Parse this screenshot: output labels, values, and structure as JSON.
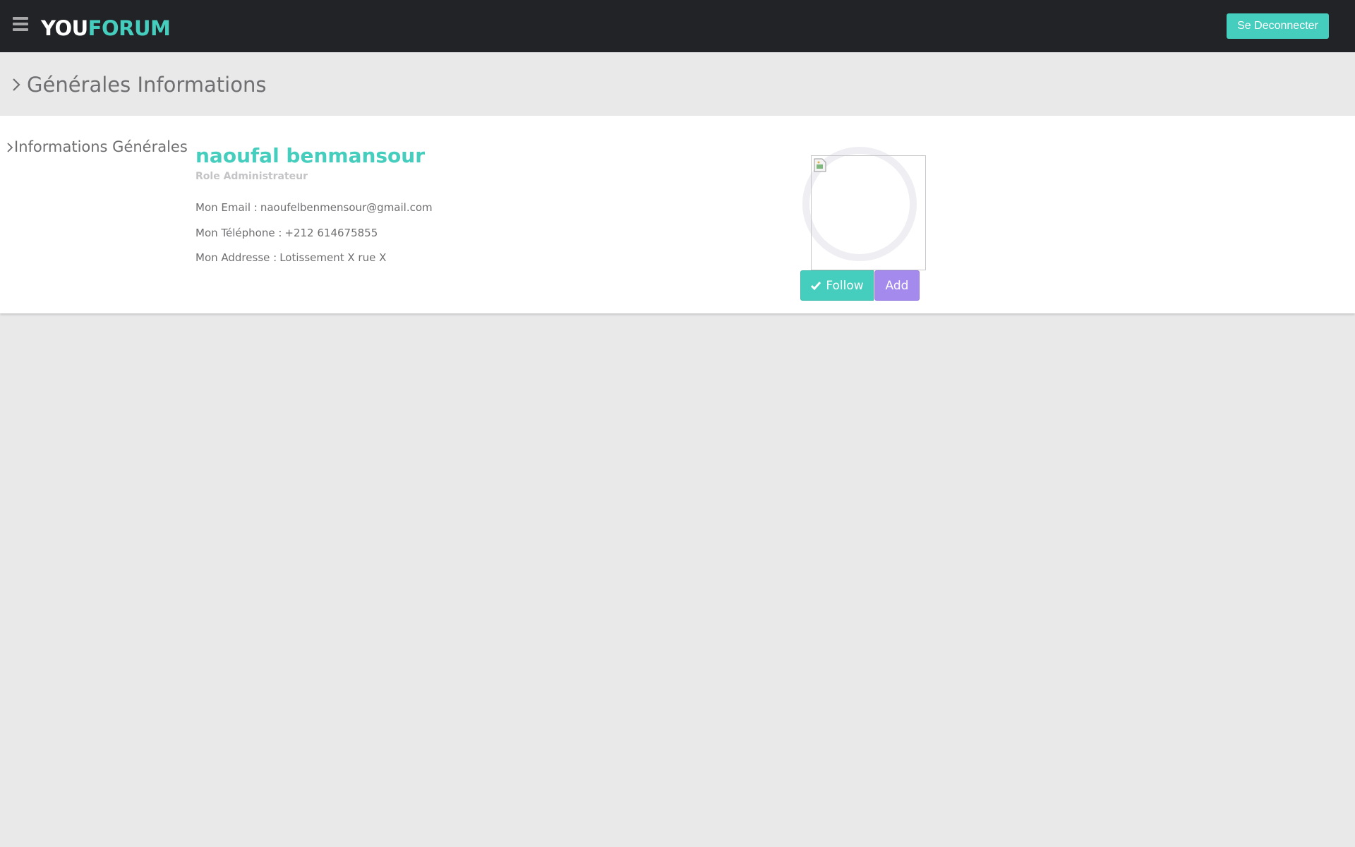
{
  "navbar": {
    "brand_you": "YOU",
    "brand_forum": "FORUM",
    "menu_icon": "hamburger-icon",
    "logout_label": "Se Deconnecter"
  },
  "header": {
    "title": "Générales Informations",
    "icon": "chevron-right-icon"
  },
  "profile": {
    "section_label": "Informations Générales",
    "name": "naoufal benmansour",
    "role": "Role Administrateur",
    "email_label": "Mon Email :",
    "email_value": "naoufelbenmensour@gmail.com",
    "phone_label": "Mon Téléphone :",
    "phone_value": "+212 614675855",
    "address_label": "Mon Addresse :",
    "address_value": "Lotissement X rue X"
  },
  "actions": {
    "follow_label": "Follow",
    "follow_icon": "check-icon",
    "add_label": "Add"
  },
  "colors": {
    "navbar_bg": "#222327",
    "accent": "#45cdbd",
    "purple": "#a58aee",
    "page_bg": "#e9e9ea",
    "text_muted": "#6f6f72"
  }
}
